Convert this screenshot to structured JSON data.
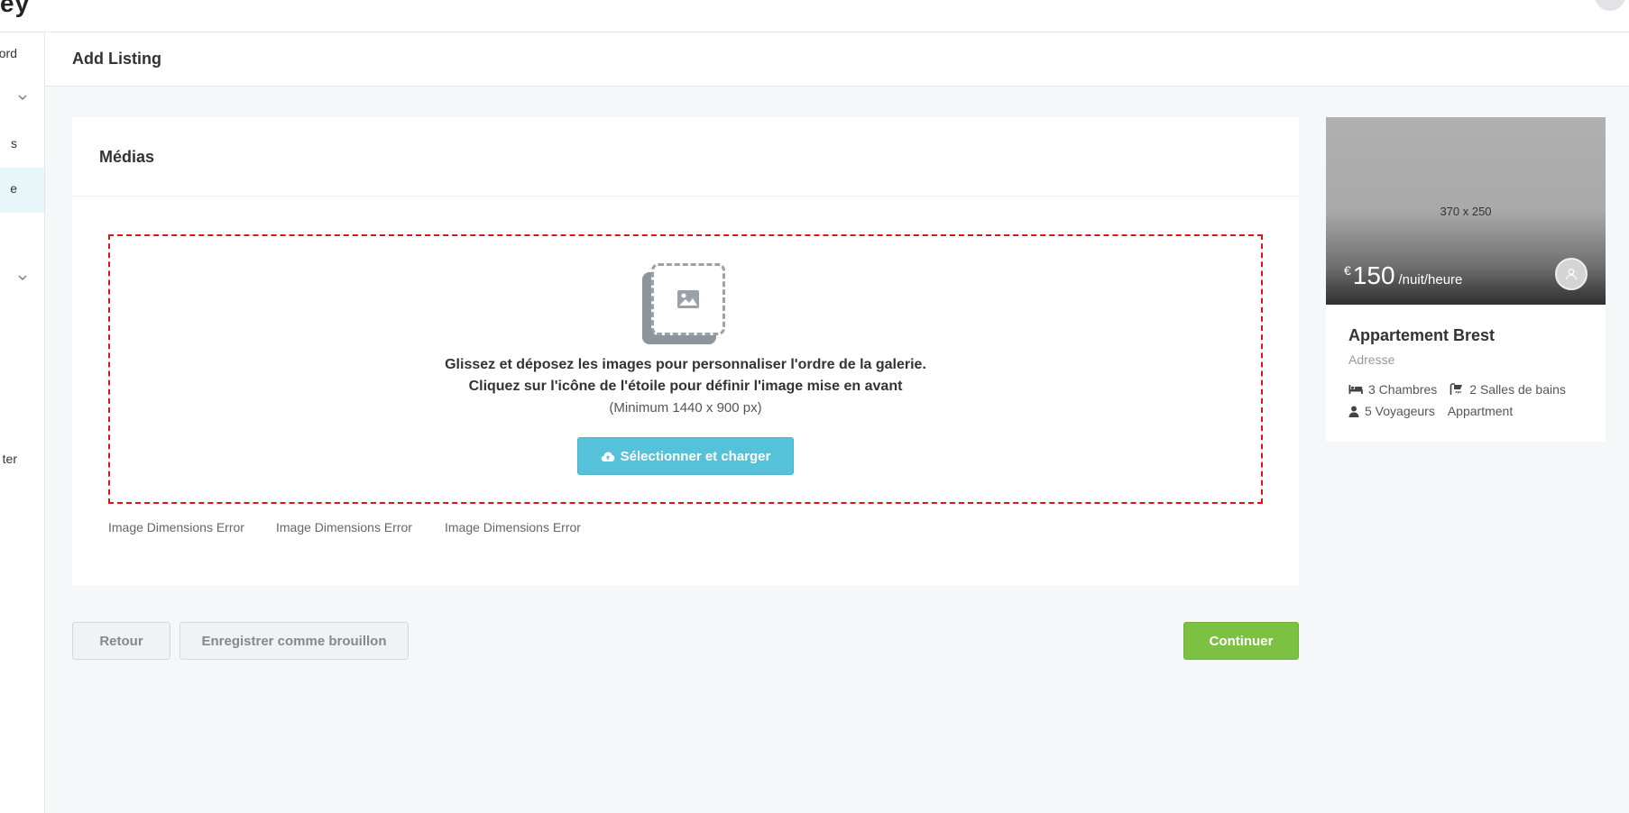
{
  "app": {
    "logo_fragment": "ey"
  },
  "sidebar": {
    "items": [
      {
        "label": "ord",
        "has_chevron": false
      },
      {
        "label": "",
        "has_chevron": true
      },
      {
        "label": "s",
        "has_chevron": false
      },
      {
        "label": "e",
        "has_chevron": false,
        "active": true
      },
      {
        "label": "",
        "has_chevron": true
      },
      {
        "label": "ter",
        "has_chevron": false
      }
    ]
  },
  "header": {
    "title": "Add Listing"
  },
  "media_card": {
    "title": "Médias",
    "dropzone": {
      "line1": "Glissez et déposez les images pour personnaliser l'ordre de la galerie.",
      "line2": "Cliquez sur l'icône de l'étoile pour définir l'image mise en avant",
      "line3": "(Minimum 1440 x 900 px)",
      "upload_label": "Sélectionner et charger",
      "border_color": "#e0101e"
    },
    "errors": [
      "Image Dimensions Error",
      "Image Dimensions Error",
      "Image Dimensions Error"
    ]
  },
  "actions": {
    "back_label": "Retour",
    "draft_label": "Enregistrer comme brouillon",
    "continue_label": "Continuer"
  },
  "preview": {
    "placeholder_dims": "370 x 250",
    "currency": "€",
    "price": "150",
    "price_unit": "/nuit/heure",
    "title": "Appartement Brest",
    "address": "Adresse",
    "bedrooms": "3 Chambres",
    "bathrooms": "2 Salles de bains",
    "guests": "5 Voyageurs",
    "type": "Appartment"
  },
  "colors": {
    "accent_upload": "#55c2d9",
    "continue": "#7dc142",
    "active_sidebar": "#e7f6f8"
  }
}
